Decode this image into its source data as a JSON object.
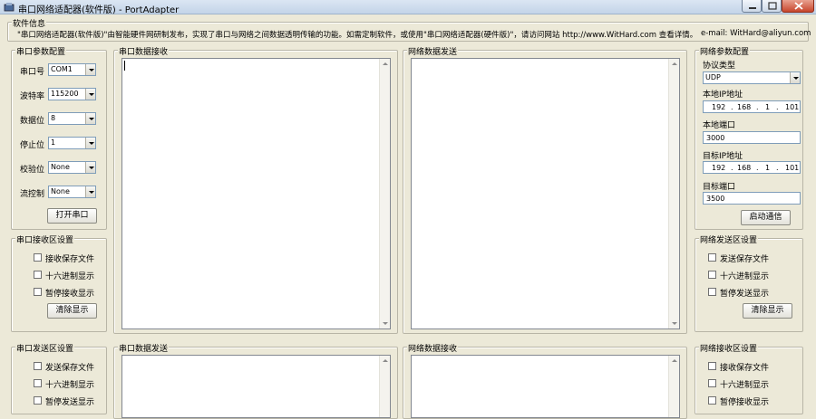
{
  "window": {
    "title": "串口网络适配器(软件版) - PortAdapter"
  },
  "info": {
    "legend": "软件信息",
    "text": "\"串口网络适配器(软件版)\"由智能硬件网研制发布，实现了串口与网络之间数据透明传输的功能。如需定制软件，或使用\"串口网络适配器(硬件版)\"，请访问网站 http://www.WitHard.com 查看详情。",
    "email": "e-mail: WitHard@aliyun.com"
  },
  "serial_config": {
    "legend": "串口参数配置",
    "fields": [
      {
        "label": "串口号",
        "value": "COM1"
      },
      {
        "label": "波特率",
        "value": "115200"
      },
      {
        "label": "数据位",
        "value": "8"
      },
      {
        "label": "停止位",
        "value": "1"
      },
      {
        "label": "校验位",
        "value": "None"
      },
      {
        "label": "流控制",
        "value": "None"
      }
    ],
    "open_button": "打开串口"
  },
  "serial_recv_settings": {
    "legend": "串口接收区设置",
    "checks": [
      "接收保存文件",
      "十六进制显示",
      "暂停接收显示"
    ],
    "clear_button": "清除显示"
  },
  "serial_send_settings": {
    "legend": "串口发送区设置",
    "checks": [
      "发送保存文件",
      "十六进制显示",
      "暂停发送显示"
    ]
  },
  "panes": {
    "serial_recv": "串口数据接收",
    "net_send": "网络数据发送",
    "serial_send": "串口数据发送",
    "net_recv": "网络数据接收"
  },
  "net_config": {
    "legend": "网络参数配置",
    "protocol_label": "协议类型",
    "protocol_value": "UDP",
    "local_ip_label": "本地IP地址",
    "local_ip": [
      "192",
      "168",
      "1",
      "101"
    ],
    "local_port_label": "本地端口",
    "local_port": "3000",
    "remote_ip_label": "目标IP地址",
    "remote_ip": [
      "192",
      "168",
      "1",
      "101"
    ],
    "remote_port_label": "目标端口",
    "remote_port": "3500",
    "start_button": "启动通信"
  },
  "net_send_settings": {
    "legend": "网络发送区设置",
    "checks": [
      "发送保存文件",
      "十六进制显示",
      "暂停发送显示"
    ],
    "clear_button": "清除显示"
  },
  "net_recv_settings": {
    "legend": "网络接收区设置",
    "checks": [
      "接收保存文件",
      "十六进制显示",
      "暂停接收显示"
    ]
  }
}
